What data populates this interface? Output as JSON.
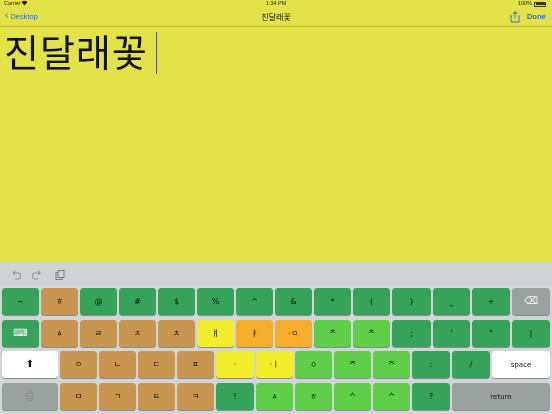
{
  "status_bar": {
    "carrier": "Carrier",
    "time": "1:34 PM",
    "battery": "100%"
  },
  "nav": {
    "back_label": "Desktop",
    "title": "진달래꽃",
    "done_label": "Done"
  },
  "editor": {
    "text": "진달래꽃"
  },
  "toolbar": {
    "icons": [
      "undo-icon",
      "redo-icon",
      "paste-icon"
    ]
  },
  "colors": {
    "background": "#e3e349",
    "green": "#35a35a",
    "brown": "#c9964f",
    "yellow": "#f3ee2c",
    "orange": "#f6ad2b",
    "light_green": "#5fcf4a",
    "gray": "#9aa29f",
    "white": "#ffffff",
    "accent": "#2770d8"
  },
  "keyboard": {
    "rows": [
      [
        {
          "label": "~",
          "color": "green"
        },
        {
          "label": "ㅎ",
          "color": "brown"
        },
        {
          "label": "@",
          "color": "green"
        },
        {
          "label": "#",
          "color": "green"
        },
        {
          "label": "$",
          "color": "green"
        },
        {
          "label": "%",
          "color": "green"
        },
        {
          "label": "^",
          "color": "green"
        },
        {
          "label": "&",
          "color": "green"
        },
        {
          "label": "*",
          "color": "green"
        },
        {
          "label": "(",
          "color": "green"
        },
        {
          "label": ")",
          "color": "green"
        },
        {
          "label": "_",
          "color": "green"
        },
        {
          "label": "+",
          "color": "green"
        },
        {
          "label": "⌫",
          "color": "gray",
          "icon": "backspace-icon"
        }
      ],
      [
        {
          "label": "⌨",
          "color": "green",
          "icon": "keyboard-icon"
        },
        {
          "label": "ㅿ",
          "color": "brown"
        },
        {
          "label": "ㄹ",
          "color": "brown"
        },
        {
          "label": "ㅈ",
          "color": "brown"
        },
        {
          "label": "ㅊ",
          "color": "brown"
        },
        {
          "label": "ㅒ",
          "color": "yellow"
        },
        {
          "label": "ㅑ",
          "color": "orange"
        },
        {
          "label": "·ㅇ",
          "color": "orange"
        },
        {
          "label": "ᄎ",
          "color": "light_green"
        },
        {
          "label": "ᄎ",
          "color": "light_green"
        },
        {
          "label": ";",
          "color": "green"
        },
        {
          "label": "'",
          "color": "green"
        },
        {
          "label": "\"",
          "color": "green"
        },
        {
          "label": "|",
          "color": "green"
        }
      ],
      [
        {
          "label": "⬆",
          "color": "white",
          "icon": "shift-icon"
        },
        {
          "label": "ㅇ",
          "color": "brown"
        },
        {
          "label": "ㄴ",
          "color": "brown"
        },
        {
          "label": "ㄷ",
          "color": "brown"
        },
        {
          "label": "ㅍ",
          "color": "brown"
        },
        {
          "label": "·",
          "color": "yellow"
        },
        {
          "label": "·ㅣ",
          "color": "yellow"
        },
        {
          "label": "ㆁ",
          "color": "light_green"
        },
        {
          "label": "ᄌ",
          "color": "light_green"
        },
        {
          "label": "ᄌ",
          "color": "light_green"
        },
        {
          "label": ":",
          "color": "green"
        },
        {
          "label": "/",
          "color": "green"
        },
        {
          "label": "space",
          "color": "white"
        }
      ],
      [
        {
          "label": "🌐",
          "color": "gray",
          "icon": "globe-icon"
        },
        {
          "label": "ㅁ",
          "color": "brown"
        },
        {
          "label": "ㄱ",
          "color": "brown"
        },
        {
          "label": "ㅌ",
          "color": "brown"
        },
        {
          "label": "ㅋ",
          "color": "brown"
        },
        {
          "label": "!",
          "color": "green"
        },
        {
          "label": "ㅿ",
          "color": "light_green"
        },
        {
          "label": "ㆆ",
          "color": "light_green"
        },
        {
          "label": "ᄉ",
          "color": "light_green"
        },
        {
          "label": "ᄉ",
          "color": "light_green"
        },
        {
          "label": "?",
          "color": "green"
        },
        {
          "label": "return",
          "color": "gray"
        }
      ]
    ]
  }
}
